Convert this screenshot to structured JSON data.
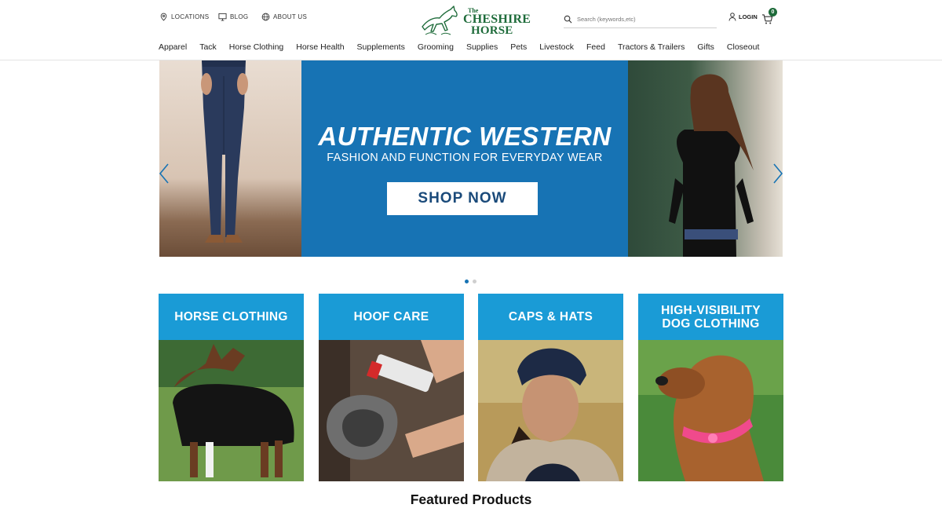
{
  "header": {
    "utilities": [
      {
        "label": "LOCATIONS",
        "icon": "location-pin-icon"
      },
      {
        "label": "BLOG",
        "icon": "monitor-icon"
      },
      {
        "label": "ABOUT US",
        "icon": "globe-icon"
      }
    ],
    "logo": {
      "line0": "The",
      "line1": "CHESHIRE",
      "line2": "HORSE"
    },
    "search": {
      "placeholder": "Search (keywords,etc)"
    },
    "login_label": "LOGIN",
    "cart_count": "0"
  },
  "nav": {
    "items": [
      "Apparel",
      "Tack",
      "Horse Clothing",
      "Horse Health",
      "Supplements",
      "Grooming",
      "Supplies",
      "Pets",
      "Livestock",
      "Feed",
      "Tractors & Trailers",
      "Gifts",
      "Closeout"
    ]
  },
  "hero": {
    "headline": "AUTHENTIC WESTERN",
    "subheadline": "FASHION AND FUNCTION FOR EVERYDAY WEAR",
    "cta_label": "SHOP NOW",
    "slide_count": 2,
    "active_slide": 1
  },
  "categories": [
    {
      "label": "HORSE CLOTHING"
    },
    {
      "label": "HOOF CARE"
    },
    {
      "label": "CAPS & HATS"
    },
    {
      "label": "HIGH-VISIBILITY DOG CLOTHING"
    }
  ],
  "featured_title": "Featured Products",
  "colors": {
    "brand_green": "#1e6b3a",
    "hero_blue": "#1773b4",
    "tile_blue": "#1a9bd6"
  }
}
